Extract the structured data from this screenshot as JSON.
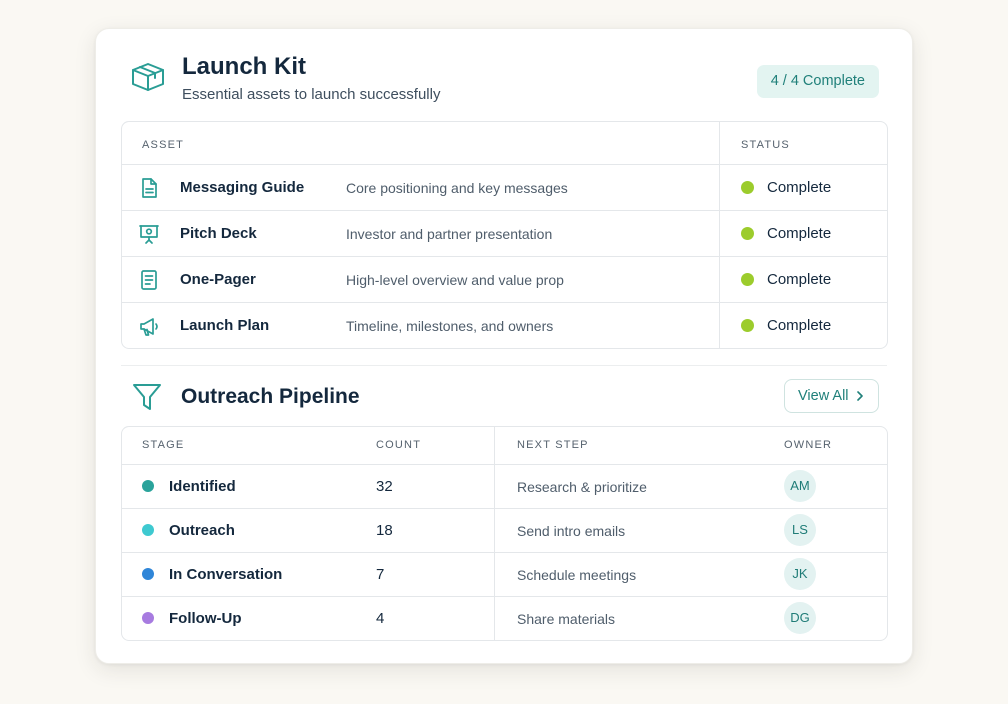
{
  "launch_kit": {
    "title": "Launch Kit",
    "subtitle": "Essential assets to launch successfully",
    "badge": "4 / 4 Complete",
    "icon": "package-box-icon",
    "columns": {
      "asset": "ASSET",
      "status": "STATUS"
    },
    "assets": [
      {
        "icon": "document-icon",
        "name": "Messaging Guide",
        "description": "Core positioning and key messages",
        "status": "Complete"
      },
      {
        "icon": "presentation-icon",
        "name": "Pitch Deck",
        "description": "Investor and partner presentation",
        "status": "Complete"
      },
      {
        "icon": "one-pager-icon",
        "name": "One-Pager",
        "description": "High-level overview and value prop",
        "status": "Complete"
      },
      {
        "icon": "megaphone-icon",
        "name": "Launch Plan",
        "description": "Timeline, milestones, and owners",
        "status": "Complete"
      }
    ],
    "status_color": "#9ccc2c"
  },
  "pipeline": {
    "title": "Outreach Pipeline",
    "icon": "funnel-icon",
    "view_all": "View All",
    "columns": {
      "stage": "STAGE",
      "count": "COUNT",
      "next_step": "NEXT STEP",
      "owner": "OWNER"
    },
    "rows": [
      {
        "stage": "Identified",
        "count": "32",
        "next_step": "Research & prioritize",
        "owner": "AM",
        "color": "#2aa39b"
      },
      {
        "stage": "Outreach",
        "count": "18",
        "next_step": "Send intro emails",
        "owner": "LS",
        "color": "#3ec9d0"
      },
      {
        "stage": "In Conversation",
        "count": "7",
        "next_step": "Schedule meetings",
        "owner": "JK",
        "color": "#2f86d8"
      },
      {
        "stage": "Follow-Up",
        "count": "4",
        "next_step": "Share materials",
        "owner": "DG",
        "color": "#a77be0"
      }
    ]
  },
  "colors": {
    "accent": "#20807a",
    "background": "#faf8f3"
  }
}
